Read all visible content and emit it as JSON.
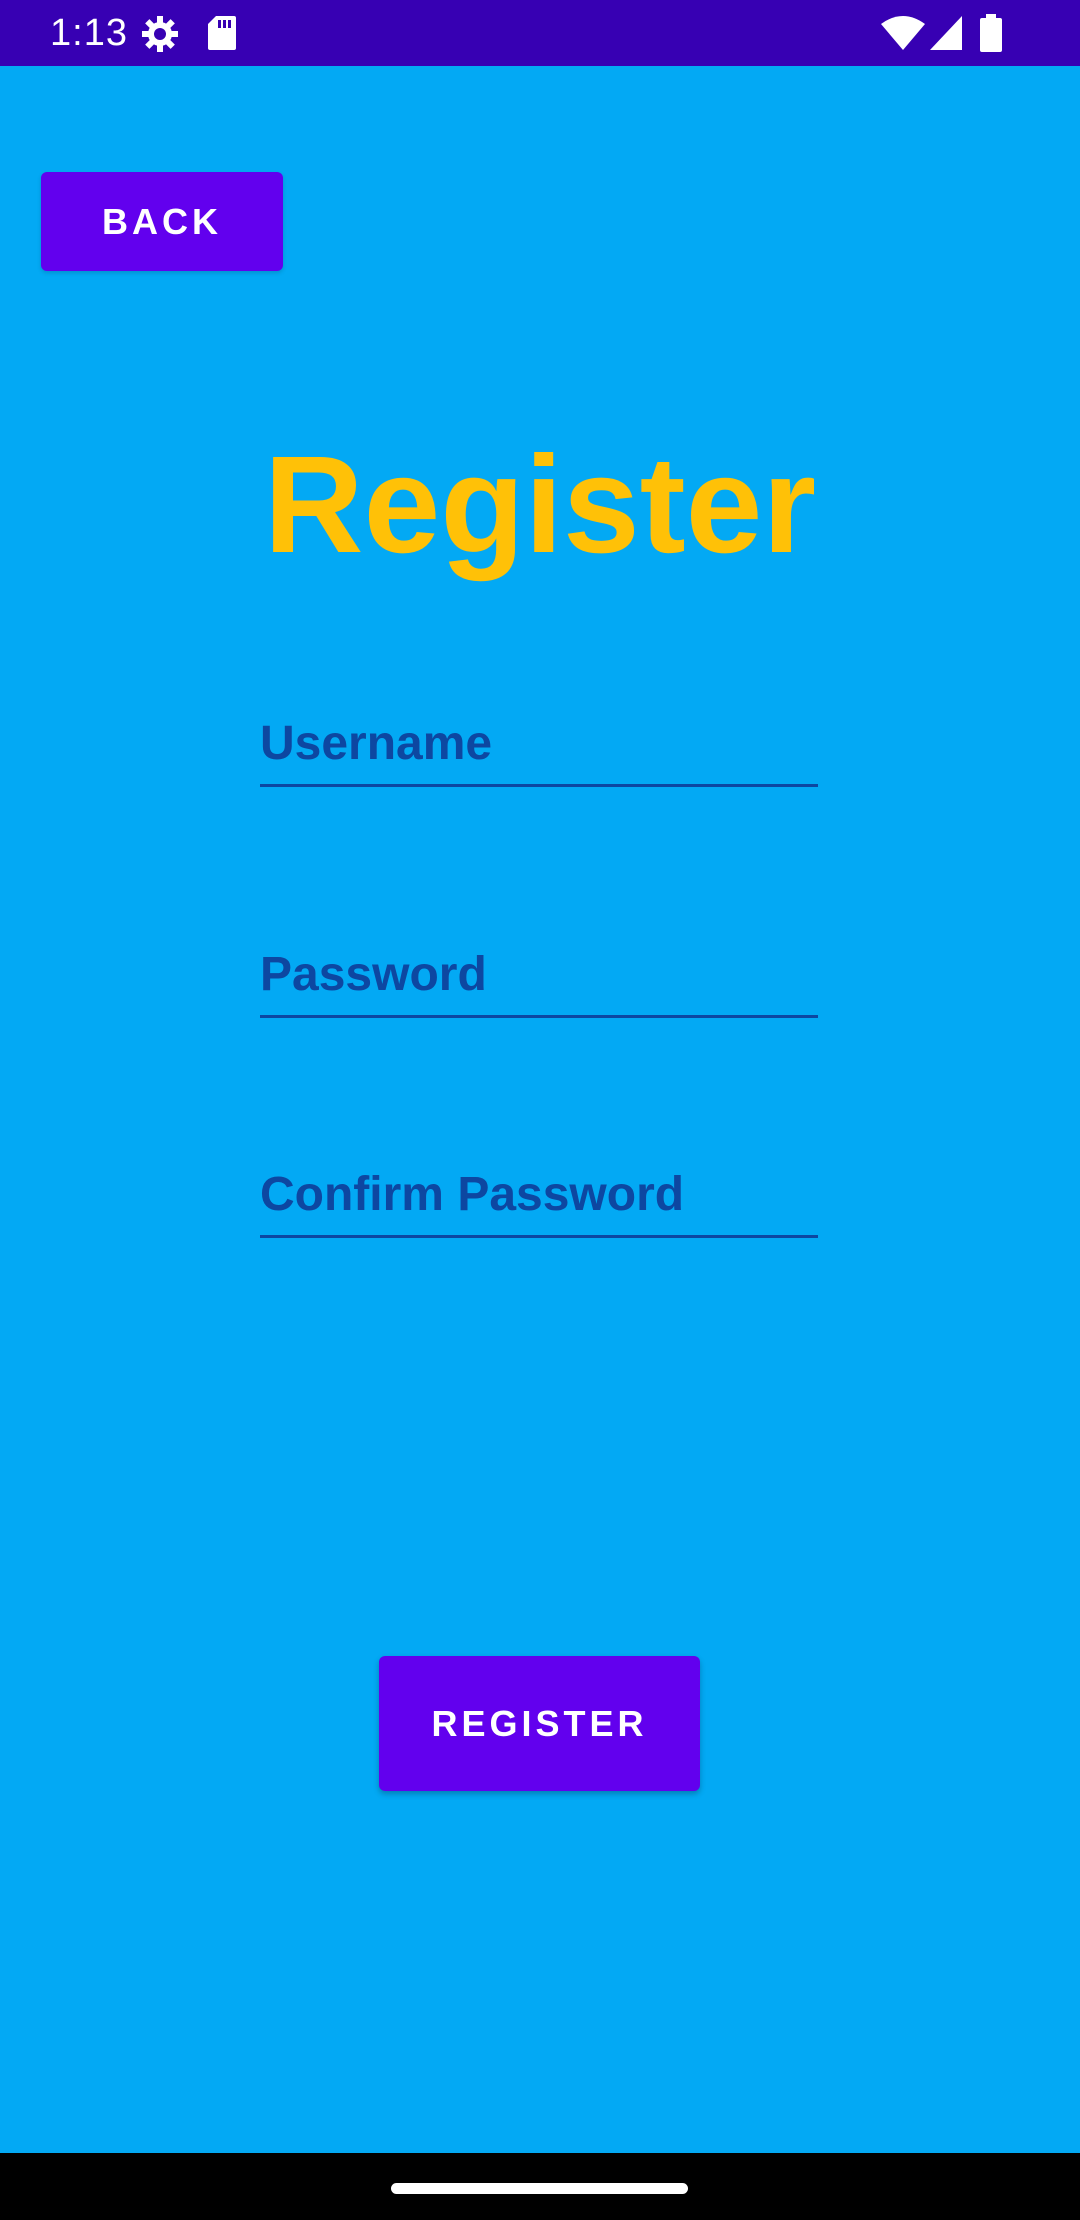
{
  "status_bar": {
    "time": "1:13",
    "icons": [
      "settings-gear-icon",
      "sd-card-icon",
      "wifi-icon",
      "cell-signal-icon",
      "battery-icon"
    ],
    "background": "#3700B3"
  },
  "screen": {
    "background": "#03A9F4",
    "back_label": "BACK",
    "title": "Register",
    "title_color": "#FFC107",
    "fields": {
      "username_hint": "Username",
      "password_hint": "Password",
      "confirm_password_hint": "Confirm Password"
    },
    "register_label": "REGISTER",
    "button_color": "#6200EE"
  }
}
